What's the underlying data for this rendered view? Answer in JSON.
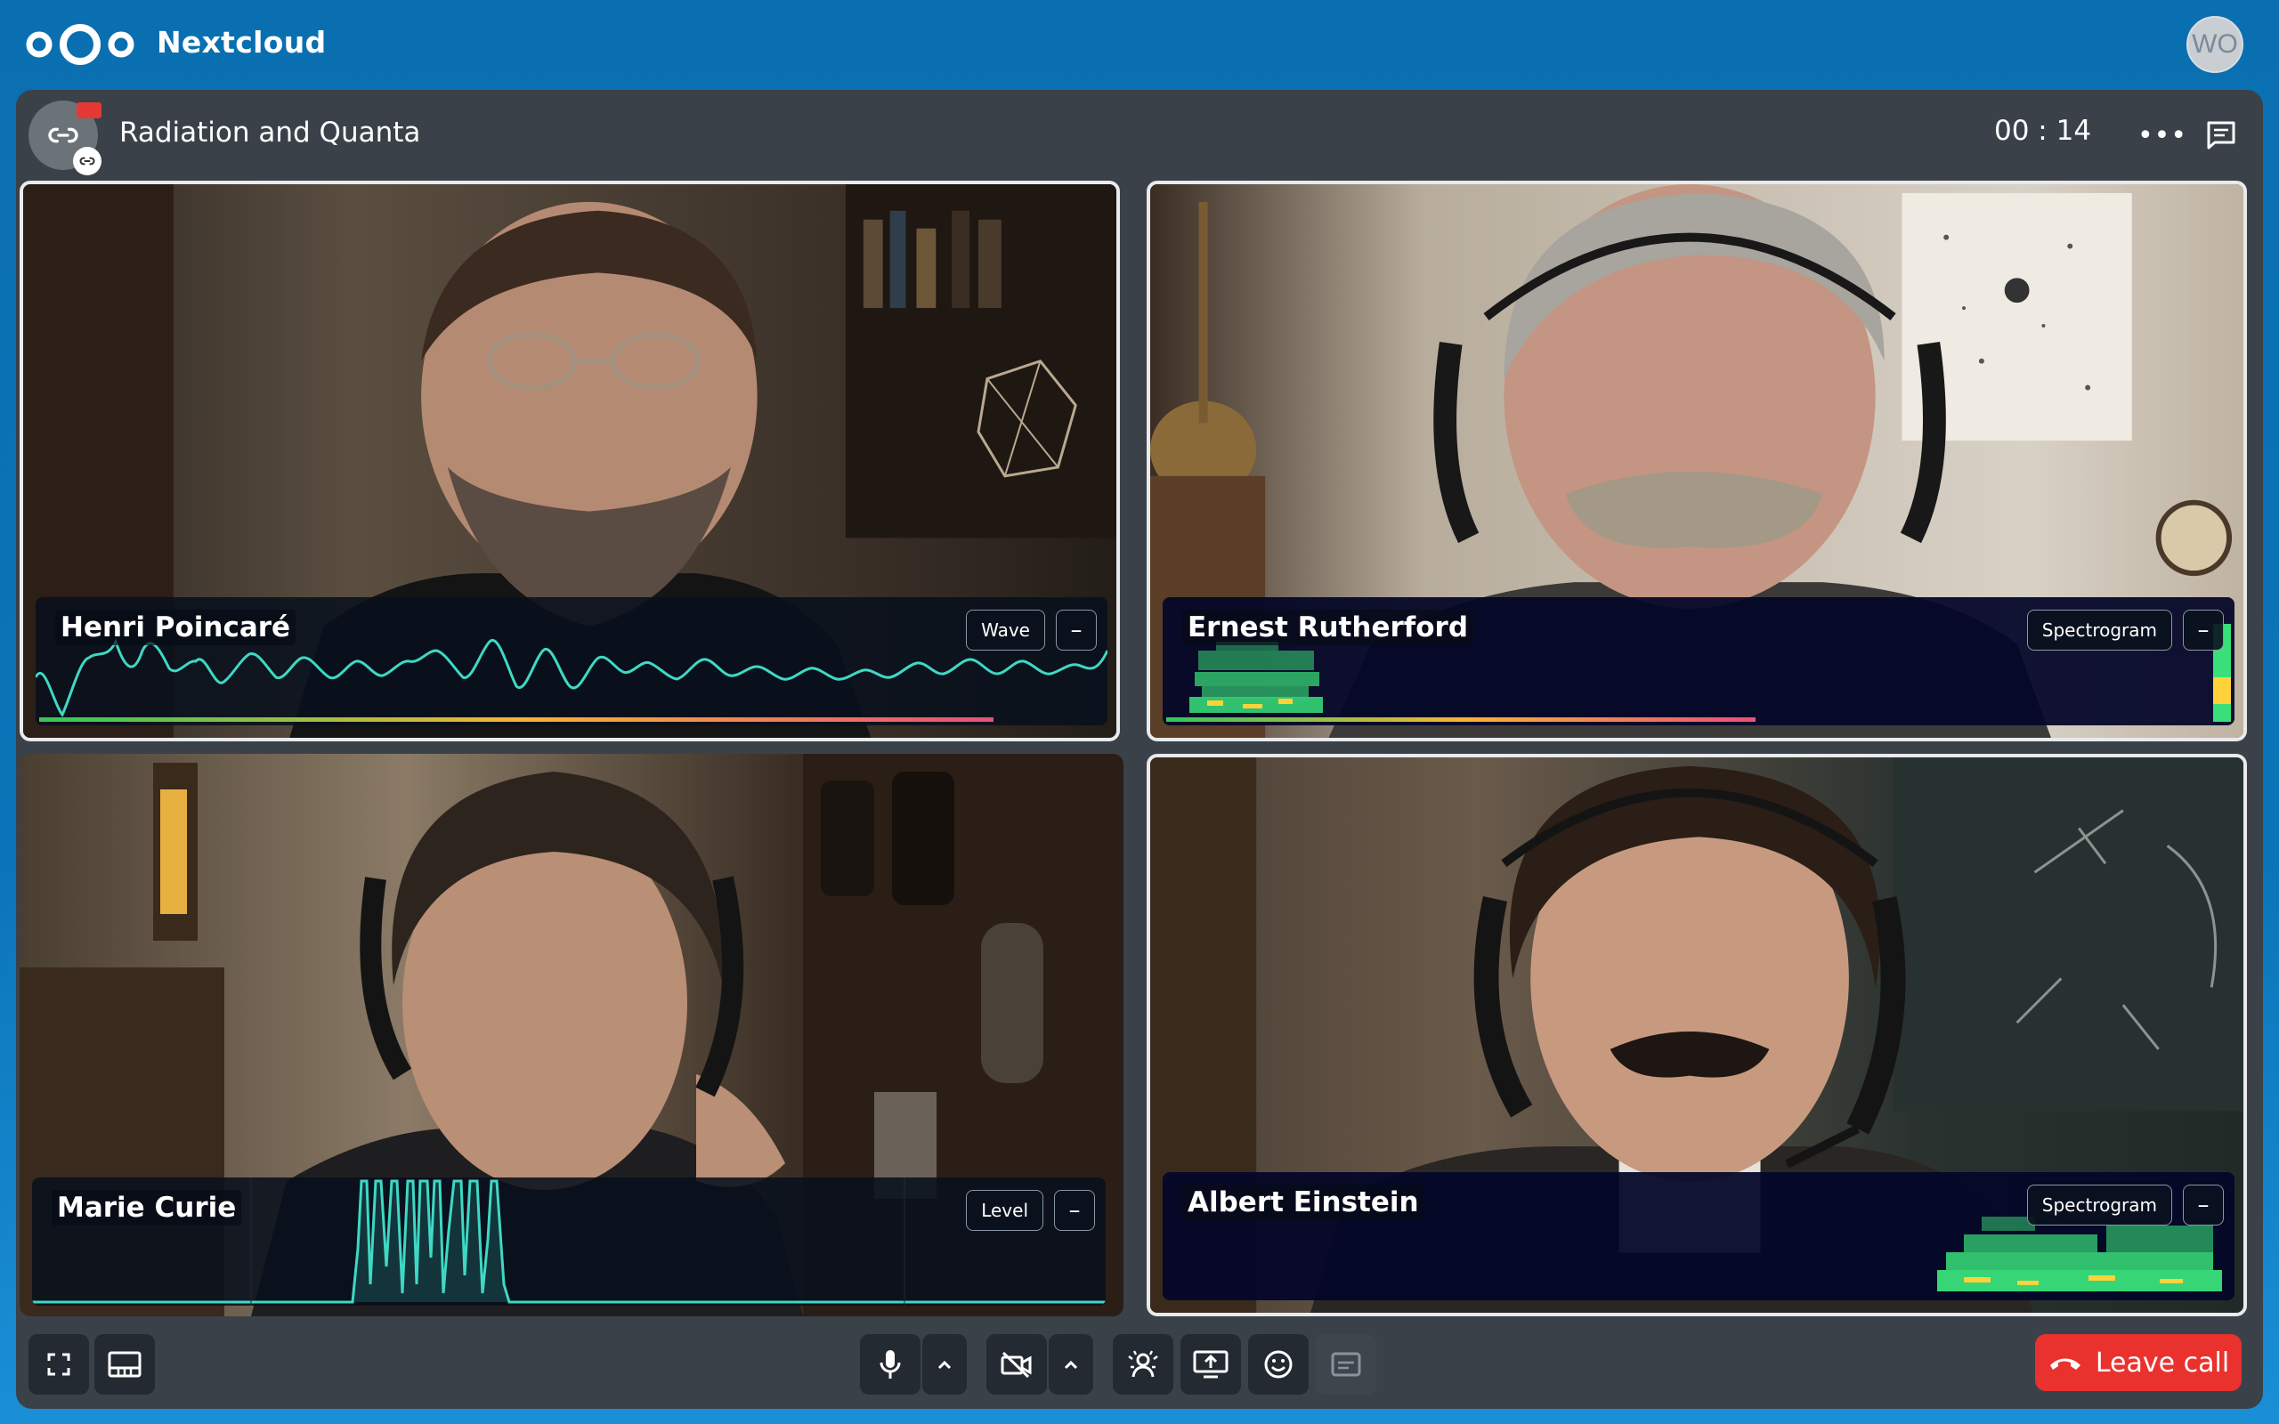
{
  "app": {
    "brand": "Nextcloud",
    "user_initials": "WO"
  },
  "call": {
    "title": "Radiation and Quanta",
    "timer": "00 : 14",
    "more_label": "•••"
  },
  "tiles": [
    {
      "name": "Henri Poincaré",
      "mode": "Wave",
      "minimize": "–",
      "level": 0.89,
      "selected": true
    },
    {
      "name": "Ernest Rutherford",
      "mode": "Spectrogram",
      "minimize": "–",
      "level": 0.55,
      "selected": true
    },
    {
      "name": "Marie Curie",
      "mode": "Level",
      "minimize": "–",
      "selected": false
    },
    {
      "name": "Albert Einstein",
      "mode": "Spectrogram",
      "minimize": "–",
      "selected": true
    }
  ],
  "controls": {
    "leave_label": "Leave call"
  },
  "colors": {
    "header_bg": "#0a6fb0",
    "call_bg": "#3a4149",
    "wave": "#3fd8c4",
    "leave": "#e9322e",
    "spectrogram": "#39e07a"
  },
  "icons": [
    "nextcloud-logo-icon",
    "link-icon",
    "camera-icon",
    "more-icon",
    "chat-icon",
    "fullscreen-icon",
    "grid-view-icon",
    "microphone-icon",
    "chevron-up-icon",
    "video-off-icon",
    "background-blur-icon",
    "screen-share-icon",
    "emoji-icon",
    "captions-icon",
    "phone-hangup-icon"
  ]
}
